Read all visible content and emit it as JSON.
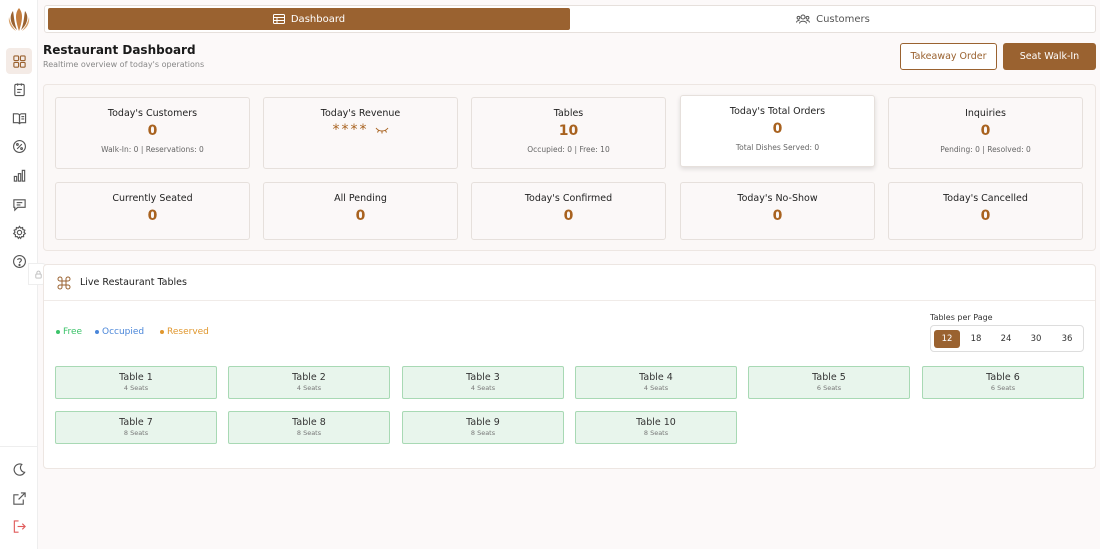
{
  "nav": {
    "dashboard_tab": "Dashboard",
    "customers_tab": "Customers"
  },
  "header": {
    "title": "Restaurant Dashboard",
    "subtitle": "Realtime overview of today's operations",
    "takeaway_label": "Takeaway Order",
    "seat_walkin_label": "Seat Walk-In"
  },
  "stats": [
    {
      "label": "Today's Customers",
      "value": "0",
      "sub": "Walk-In: 0 | Reservations: 0"
    },
    {
      "label": "Today's Revenue",
      "value": "****",
      "sub": ""
    },
    {
      "label": "Tables",
      "value": "10",
      "sub": "Occupied: 0 | Free: 10"
    },
    {
      "label": "Today's Total Orders",
      "value": "0",
      "sub": "Total Dishes Served: 0"
    },
    {
      "label": "Inquiries",
      "value": "0",
      "sub": "Pending: 0 | Resolved: 0"
    },
    {
      "label": "Currently Seated",
      "value": "0",
      "sub": ""
    },
    {
      "label": "All Pending",
      "value": "0",
      "sub": ""
    },
    {
      "label": "Today's Confirmed",
      "value": "0",
      "sub": ""
    },
    {
      "label": "Today's No-Show",
      "value": "0",
      "sub": ""
    },
    {
      "label": "Today's Cancelled",
      "value": "0",
      "sub": ""
    }
  ],
  "tables_section": {
    "title": "Live Restaurant Tables",
    "legend": [
      {
        "label": "Free",
        "color": "#3cc36a"
      },
      {
        "label": "Occupied",
        "color": "#4a86d9"
      },
      {
        "label": "Reserved",
        "color": "#e0972e"
      }
    ],
    "per_page_label": "Tables per Page",
    "per_page_options": [
      "12",
      "18",
      "24",
      "30",
      "36"
    ],
    "per_page_selected": "12",
    "tables": [
      {
        "name": "Table 1",
        "seats": "4 Seats",
        "status": "free"
      },
      {
        "name": "Table 2",
        "seats": "4 Seats",
        "status": "free"
      },
      {
        "name": "Table 3",
        "seats": "4 Seats",
        "status": "free"
      },
      {
        "name": "Table 4",
        "seats": "4 Seats",
        "status": "free"
      },
      {
        "name": "Table 5",
        "seats": "6 Seats",
        "status": "free"
      },
      {
        "name": "Table 6",
        "seats": "6 Seats",
        "status": "free"
      },
      {
        "name": "Table 7",
        "seats": "8 Seats",
        "status": "free"
      },
      {
        "name": "Table 8",
        "seats": "8 Seats",
        "status": "free"
      },
      {
        "name": "Table 9",
        "seats": "8 Seats",
        "status": "free"
      },
      {
        "name": "Table 10",
        "seats": "8 Seats",
        "status": "free"
      }
    ]
  },
  "colors": {
    "accent": "#9a6230",
    "value_text": "#a8621f",
    "free_bg": "#e8f5ec",
    "free_border": "#a8d9b4"
  },
  "sidebar_icons": [
    "logo-icon",
    "dashboard-icon",
    "reservations-icon",
    "menu-book-icon",
    "offers-icon",
    "reports-icon",
    "messages-icon",
    "settings-icon",
    "help-icon",
    "lock-icon",
    "dark-mode-icon",
    "external-link-icon",
    "logout-icon"
  ]
}
